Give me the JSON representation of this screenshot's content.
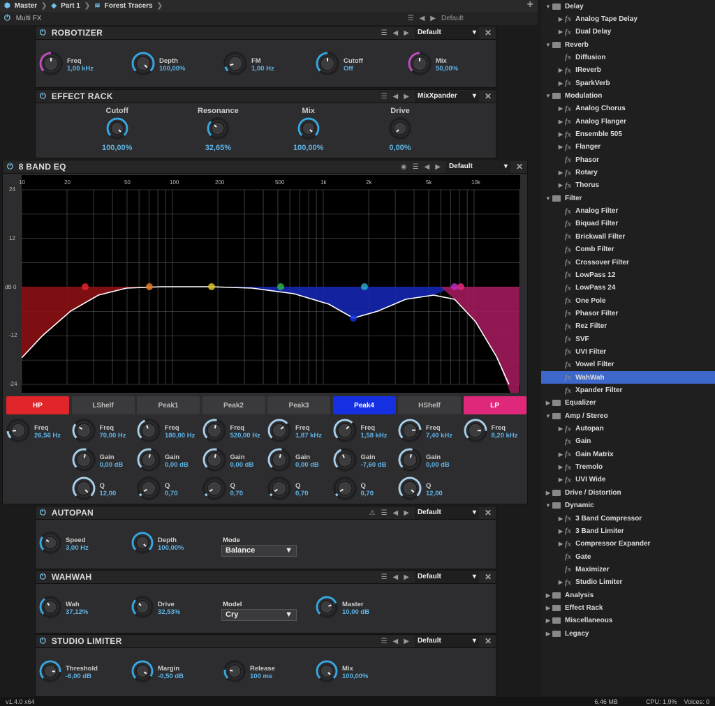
{
  "breadcrumb": [
    "Master",
    "Part 1",
    "Forest Tracers"
  ],
  "multifx": {
    "title": "Multi FX",
    "preset": "Default"
  },
  "robotizer": {
    "title": "ROBOTIZER",
    "preset": "Default",
    "knobs": [
      {
        "label": "Freq",
        "value": "1,00 kHz",
        "fill": 0.5,
        "ring": "#c04fc0"
      },
      {
        "label": "Depth",
        "value": "100,00%",
        "fill": 1.0,
        "ring": "#3aa6e0"
      },
      {
        "label": "FM",
        "value": "1,00 Hz",
        "fill": 0.1,
        "ring": "#3aa6e0"
      },
      {
        "label": "Cutoff",
        "value": "Off",
        "fill": 0.5,
        "ring": "#3aa6e0"
      },
      {
        "label": "Mix",
        "value": "50,00%",
        "fill": 0.5,
        "ring": "#c04fc0"
      }
    ]
  },
  "effect_rack": {
    "title": "EFFECT RACK",
    "preset": "MixXpander",
    "knobs": [
      {
        "label": "Cutoff",
        "value": "100,00%",
        "fill": 1.0
      },
      {
        "label": "Resonance",
        "value": "32,65%",
        "fill": 0.33
      },
      {
        "label": "Mix",
        "value": "100,00%",
        "fill": 1.0
      },
      {
        "label": "Drive",
        "value": "0,00%",
        "fill": 0.0
      }
    ]
  },
  "eq": {
    "title": "8 BAND EQ",
    "preset": "Default",
    "freq_ticks": [
      "10",
      "20",
      "50",
      "100",
      "200",
      "500",
      "1k",
      "2k",
      "5k",
      "10k"
    ],
    "db_ticks": [
      "24",
      "12",
      "dB 0",
      "-12",
      "-24"
    ],
    "bands": [
      {
        "name": "HP",
        "color": "#e0262b",
        "active": true,
        "freq": "26,56 Hz",
        "freq_fill": 0.15
      },
      {
        "name": "LShelf",
        "color": "#e07b2a",
        "active": false,
        "freq": "70,00 Hz",
        "gain": "0,00 dB",
        "q": "12,00",
        "freq_fill": 0.3,
        "q_fill": 1.0
      },
      {
        "name": "Peak1",
        "color": "#d9c22b",
        "active": false,
        "freq": "180,00 Hz",
        "gain": "0,00 dB",
        "q": "0,70",
        "freq_fill": 0.42,
        "q_fill": 0.05
      },
      {
        "name": "Peak2",
        "color": "#2db34a",
        "active": false,
        "freq": "520,00 Hz",
        "gain": "0,00 dB",
        "q": "0,70",
        "freq_fill": 0.55,
        "q_fill": 0.05
      },
      {
        "name": "Peak3",
        "color": "#2aa8c9",
        "active": false,
        "freq": "1,87 kHz",
        "gain": "0,00 dB",
        "q": "0,70",
        "freq_fill": 0.68,
        "q_fill": 0.05
      },
      {
        "name": "Peak4",
        "color": "#1530e0",
        "active": true,
        "freq": "1,58 kHz",
        "gain": "-7,60 dB",
        "q": "0,70",
        "freq_fill": 0.66,
        "q_fill": 0.05
      },
      {
        "name": "HShelf",
        "color": "#c02ac0",
        "active": false,
        "freq": "7,40 kHz",
        "gain": "0,00 dB",
        "q": "12,00",
        "freq_fill": 0.82,
        "q_fill": 1.0
      },
      {
        "name": "LP",
        "color": "#e0287a",
        "active": true,
        "freq": "8,20 kHz",
        "freq_fill": 0.84
      }
    ],
    "freq_label": "Freq",
    "gain_label": "Gain",
    "q_label": "Q"
  },
  "autopan": {
    "title": "AUTOPAN",
    "preset": "Default",
    "knobs": [
      {
        "label": "Speed",
        "value": "3,00 Hz",
        "fill": 0.3
      },
      {
        "label": "Depth",
        "value": "100,00%",
        "fill": 1.0
      }
    ],
    "mode_label": "Mode",
    "mode": "Balance"
  },
  "wahwah": {
    "title": "WAHWAH",
    "preset": "Default",
    "knobs": [
      {
        "label": "Wah",
        "value": "37,12%",
        "fill": 0.37
      },
      {
        "label": "Drive",
        "value": "32,53%",
        "fill": 0.33
      }
    ],
    "model_label": "Model",
    "model": "Cry",
    "master": {
      "label": "Master",
      "value": "10,00 dB",
      "fill": 0.75
    }
  },
  "studio_limiter": {
    "title": "STUDIO LIMITER",
    "preset": "Default",
    "knobs": [
      {
        "label": "Threshold",
        "value": "-6,00 dB",
        "fill": 0.85
      },
      {
        "label": "Margin",
        "value": "-0,50 dB",
        "fill": 0.95
      },
      {
        "label": "Release",
        "value": "100 ms",
        "fill": 0.2
      },
      {
        "label": "Mix",
        "value": "100,00%",
        "fill": 1.0
      }
    ]
  },
  "tree": [
    {
      "label": "Delay",
      "type": "folder",
      "open": true
    },
    {
      "label": "Analog Tape Delay",
      "type": "fx",
      "arrow": true
    },
    {
      "label": "Dual Delay",
      "type": "fx",
      "arrow": true
    },
    {
      "label": "Reverb",
      "type": "folder",
      "open": true
    },
    {
      "label": "Diffusion",
      "type": "fx"
    },
    {
      "label": "IReverb",
      "type": "fx",
      "arrow": true
    },
    {
      "label": "SparkVerb",
      "type": "fx",
      "arrow": true
    },
    {
      "label": "Modulation",
      "type": "folder",
      "open": true
    },
    {
      "label": "Analog Chorus",
      "type": "fx",
      "arrow": true
    },
    {
      "label": "Analog Flanger",
      "type": "fx",
      "arrow": true
    },
    {
      "label": "Ensemble 505",
      "type": "fx",
      "arrow": true
    },
    {
      "label": "Flanger",
      "type": "fx",
      "arrow": true
    },
    {
      "label": "Phasor",
      "type": "fx"
    },
    {
      "label": "Rotary",
      "type": "fx",
      "arrow": true
    },
    {
      "label": "Thorus",
      "type": "fx",
      "arrow": true
    },
    {
      "label": "Filter",
      "type": "folder",
      "open": true
    },
    {
      "label": "Analog Filter",
      "type": "fx"
    },
    {
      "label": "Biquad Filter",
      "type": "fx"
    },
    {
      "label": "Brickwall Filter",
      "type": "fx"
    },
    {
      "label": "Comb Filter",
      "type": "fx"
    },
    {
      "label": "Crossover Filter",
      "type": "fx"
    },
    {
      "label": "LowPass 12",
      "type": "fx"
    },
    {
      "label": "LowPass 24",
      "type": "fx"
    },
    {
      "label": "One Pole",
      "type": "fx"
    },
    {
      "label": "Phasor Filter",
      "type": "fx"
    },
    {
      "label": "Rez Filter",
      "type": "fx"
    },
    {
      "label": "SVF",
      "type": "fx"
    },
    {
      "label": "UVI Filter",
      "type": "fx"
    },
    {
      "label": "Vowel Filter",
      "type": "fx"
    },
    {
      "label": "WahWah",
      "type": "fx",
      "selected": true
    },
    {
      "label": "Xpander Filter",
      "type": "fx"
    },
    {
      "label": "Equalizer",
      "type": "folder"
    },
    {
      "label": "Amp / Stereo",
      "type": "folder",
      "open": true
    },
    {
      "label": "Autopan",
      "type": "fx",
      "arrow": true
    },
    {
      "label": "Gain",
      "type": "fx"
    },
    {
      "label": "Gain Matrix",
      "type": "fx",
      "arrow": true
    },
    {
      "label": "Tremolo",
      "type": "fx",
      "arrow": true
    },
    {
      "label": "UVI Wide",
      "type": "fx",
      "arrow": true
    },
    {
      "label": "Drive / Distortion",
      "type": "folder"
    },
    {
      "label": "Dynamic",
      "type": "folder",
      "open": true
    },
    {
      "label": "3 Band Compressor",
      "type": "fx",
      "arrow": true
    },
    {
      "label": "3 Band Limiter",
      "type": "fx",
      "arrow": true
    },
    {
      "label": "Compressor Expander",
      "type": "fx",
      "arrow": true
    },
    {
      "label": "Gate",
      "type": "fx"
    },
    {
      "label": "Maximizer",
      "type": "fx"
    },
    {
      "label": "Studio Limiter",
      "type": "fx",
      "arrow": true
    },
    {
      "label": "Analysis",
      "type": "folder"
    },
    {
      "label": "Effect Rack",
      "type": "folder"
    },
    {
      "label": "Miscellaneous",
      "type": "folder"
    },
    {
      "label": "Legacy",
      "type": "folder"
    }
  ],
  "status": {
    "version": "v1.4.0 x64",
    "memory": "6,46 MB",
    "cpu": "CPU: 1,9%",
    "voices": "Voices: 0"
  }
}
